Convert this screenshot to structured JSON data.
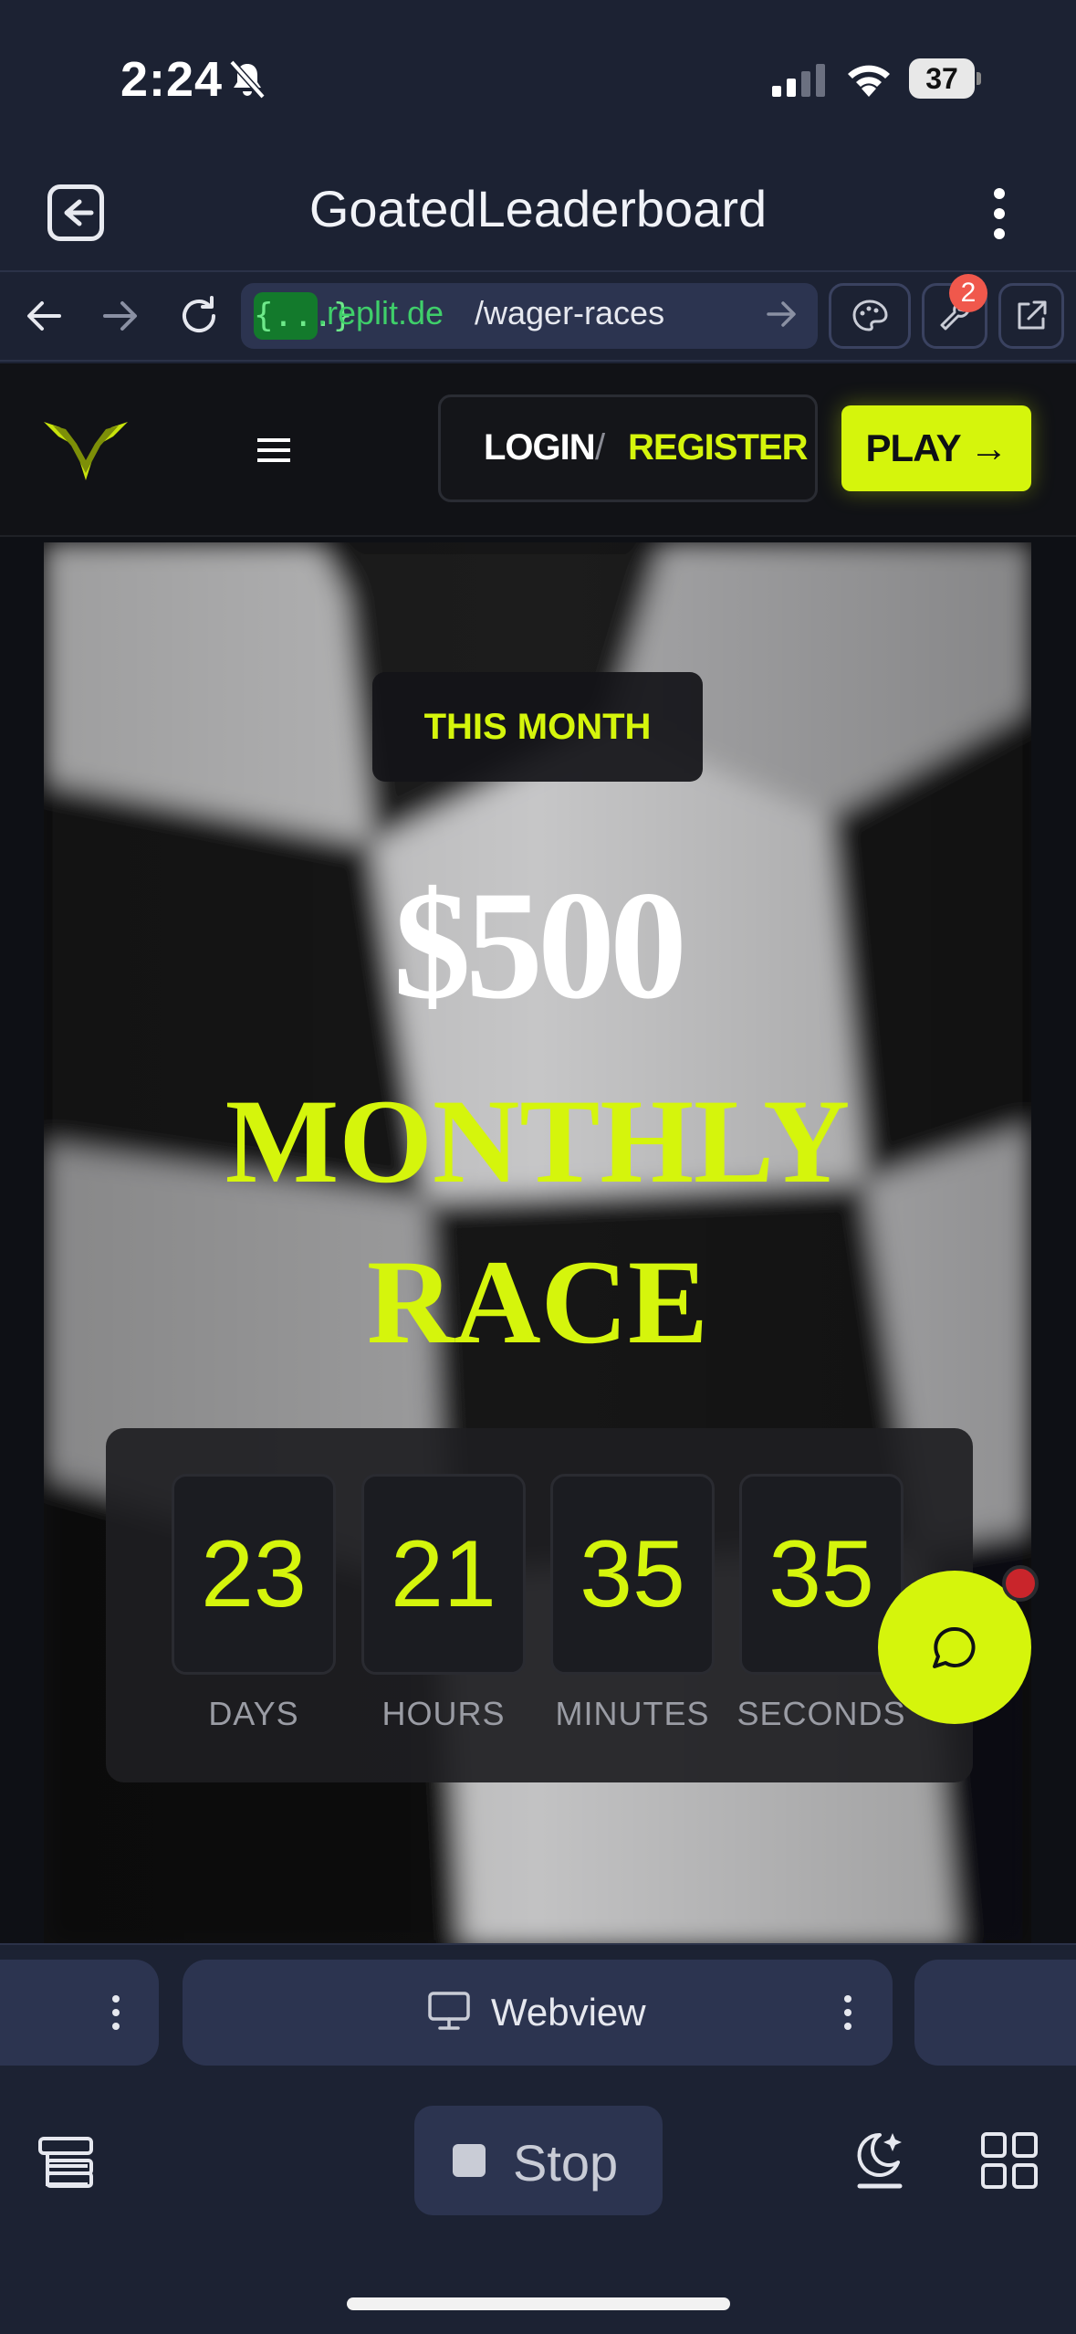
{
  "status_bar": {
    "time": "2:24",
    "battery": "37"
  },
  "app_header": {
    "title": "GoatedLeaderboard"
  },
  "url_bar": {
    "chip": "{...}",
    "domain": ".replit.de",
    "path": "/wager-races",
    "badge_count": "2"
  },
  "site_nav": {
    "login_label": "LOGIN",
    "separator": "/",
    "register_label": "REGISTER",
    "play_label": "PLAY →"
  },
  "hero": {
    "period_badge": "THIS MONTH",
    "prize": "$500",
    "title_line1": "MONTHLY",
    "title_line2": "RACE"
  },
  "countdown": [
    {
      "value": "23",
      "label": "DAYS"
    },
    {
      "value": "21",
      "label": "HOURS"
    },
    {
      "value": "35",
      "label": "MINUTES"
    },
    {
      "value": "35",
      "label": "SECONDS"
    }
  ],
  "tabs": {
    "active_label": "Webview"
  },
  "toolbar": {
    "stop_label": "Stop"
  },
  "colors": {
    "accent": "#d5f50c",
    "app_bg": "#1c2233",
    "site_bg": "#0e1015",
    "badge_red": "#f0584c"
  }
}
